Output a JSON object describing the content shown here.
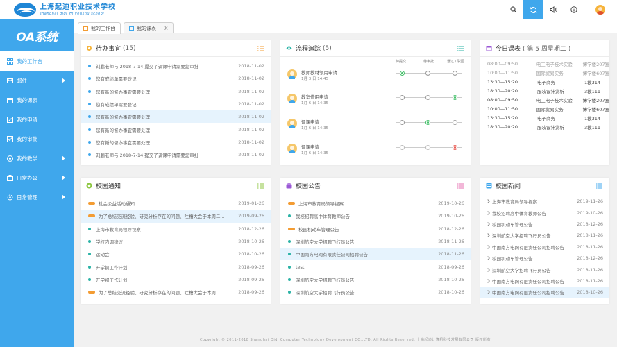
{
  "header": {
    "logo_cn": "上海起迪职业技术学校",
    "logo_en": "shanghai qidi zhiyejishu school"
  },
  "sidebar": {
    "brand": "OA系统",
    "items": [
      {
        "label": "我的工作台",
        "icon": "grid-icon"
      },
      {
        "label": "邮件",
        "icon": "mail-icon"
      },
      {
        "label": "我的课表",
        "icon": "calendar-icon"
      },
      {
        "label": "我的申请",
        "icon": "edit-icon"
      },
      {
        "label": "我的审批",
        "icon": "approve-icon"
      },
      {
        "label": "我的教学",
        "icon": "teach-icon"
      },
      {
        "label": "日常办公",
        "icon": "office-icon"
      },
      {
        "label": "日常管理",
        "icon": "manage-icon"
      }
    ]
  },
  "tabs": [
    {
      "label": "我的工作台"
    },
    {
      "label": "我的课表",
      "close": "X"
    }
  ],
  "todo": {
    "title": "待办事宜",
    "count": "(15)",
    "items": [
      {
        "text": "刘鹏老师与 2018-7-14 提交了调课申请需要您审批",
        "date": "2018-11-02"
      },
      {
        "text": "您有成绩单需要登记",
        "date": "2018-11-02"
      },
      {
        "text": "您有新的督办事宜需要处理",
        "date": "2018-11-02"
      },
      {
        "text": "您有成绩单需要登记",
        "date": "2018-11-02"
      },
      {
        "text": "您有新的督办事宜需要处理",
        "date": "2018-11-02"
      },
      {
        "text": "您有新的督办事宜需要处理",
        "date": "2018-11-02"
      },
      {
        "text": "您有新的督办事宜需要处理",
        "date": "2018-11-02"
      },
      {
        "text": "刘鹏老师与 2018-7-14 提交了调课申请需要您审批",
        "date": "2018-11-02"
      }
    ]
  },
  "workflow": {
    "title": "流程追踪",
    "count": "(5)",
    "stages": [
      "待提交",
      "待审批",
      "通过 / 驳回"
    ],
    "items": [
      {
        "name": "教师教材领用申请",
        "date": "1月 3 日 14:45"
      },
      {
        "name": "教室借用申请",
        "date": "1月 6 日 14:35"
      },
      {
        "name": "调课申请",
        "date": "1月 6 日 14:35"
      },
      {
        "name": "调课申请",
        "date": "1月 6 日 14:35"
      }
    ]
  },
  "schedule": {
    "title": "今日课表",
    "subtitle": "( 第 5 周星期二 )",
    "rows": [
      {
        "time": "08:00—09:50",
        "course": "电工电子技术实验",
        "room": "博学楼207室"
      },
      {
        "time": "10:00—11:50",
        "course": "国际贸易实务",
        "room": "博学楼607室"
      },
      {
        "time": "13:30—15:20",
        "course": "电子商务",
        "room": "1教314"
      },
      {
        "time": "18:30—20:20",
        "course": "服装设计赏析",
        "room": "3教111"
      },
      {
        "time": "08:00—09:50",
        "course": "电工电子技术实验",
        "room": "博学楼207室"
      },
      {
        "time": "10:00—11:50",
        "course": "国际贸易实务",
        "room": "博学楼607室"
      },
      {
        "time": "13:30—15:20",
        "course": "电子商务",
        "room": "1教314"
      },
      {
        "time": "18:30—20:20",
        "course": "服装设计赏析",
        "room": "3教111"
      }
    ]
  },
  "notice": {
    "title": "校园通知",
    "items": [
      {
        "text": "社会公益活动通知",
        "date": "2019-01-26",
        "mark": "pill"
      },
      {
        "text": "为了总结交流经验、研究分析存在的问题、吐槽大会于本周二...",
        "date": "2019-09-26",
        "mark": "pill"
      },
      {
        "text": "上海市教育局领导视察",
        "date": "2018-12-26",
        "mark": "dot"
      },
      {
        "text": "学校内调建议",
        "date": "2018-10-26",
        "mark": "dot"
      },
      {
        "text": "运动会",
        "date": "2018-10-26",
        "mark": "dot"
      },
      {
        "text": "开学初工作计划",
        "date": "2018-09-26",
        "mark": "dot"
      },
      {
        "text": "开学初工作计划",
        "date": "2018-09-26",
        "mark": "dot"
      },
      {
        "text": "为了总结交流经验、研究分析存在的问题、吐槽大会于本周二...",
        "date": "2018-09-26",
        "mark": "pill"
      }
    ]
  },
  "bulletin": {
    "title": "校园公告",
    "items": [
      {
        "text": "上海市教育局领导视察",
        "date": "2019-10-26",
        "mark": "pill"
      },
      {
        "text": "我校招聘高中体育教师公告",
        "date": "2019-10-26",
        "mark": "teal"
      },
      {
        "text": "校园机动车管理公告",
        "date": "2018-12-26",
        "mark": "pill"
      },
      {
        "text": "深圳航空大学招聘飞行员公告",
        "date": "2018-11-26",
        "mark": "teal"
      },
      {
        "text": "中国南方电网有限责任公司招聘公告",
        "date": "2018-11-26",
        "mark": "teal"
      },
      {
        "text": "test",
        "date": "2018-09-26",
        "mark": "teal"
      },
      {
        "text": "深圳航空大学招聘飞行员公告",
        "date": "2018-10-26",
        "mark": "teal"
      },
      {
        "text": "深圳航空大学招聘飞行员公告",
        "date": "2018-10-26",
        "mark": "teal"
      }
    ]
  },
  "news": {
    "title": "校园新闻",
    "items": [
      {
        "text": "上海市教育局领导视察",
        "date": "2019-11-26"
      },
      {
        "text": "我校招聘高中体育教师公告",
        "date": "2019-10-26"
      },
      {
        "text": "校园机动车管理公告",
        "date": "2018-12-26"
      },
      {
        "text": "深圳航空大学招聘飞行员公告",
        "date": "2018-11-26"
      },
      {
        "text": "中国南方电网有限责任公司招聘公告",
        "date": "2018-11-26"
      },
      {
        "text": "校园机动车管理公告",
        "date": "2018-12-26"
      },
      {
        "text": "深圳航空大学招聘飞行员公告",
        "date": "2018-11-26"
      },
      {
        "text": "中国南方电网有限责任公司招聘公告",
        "date": "2018-11-26"
      },
      {
        "text": "中国南方电网有限责任公司招聘公告",
        "date": "2018-10-26"
      }
    ]
  },
  "footer": "Copyright © 2011-2018 Shanghai Qidi Computer Technology Development CO.,LTD. All Rights Reserved.  上海起迪计算机科技发展有限公司 版权所有",
  "colors": {
    "accent": "#3fa7ec",
    "highlight": "#e6f3fd",
    "orange": "#f39c33",
    "green": "#44c06a",
    "red": "#e9574f"
  }
}
